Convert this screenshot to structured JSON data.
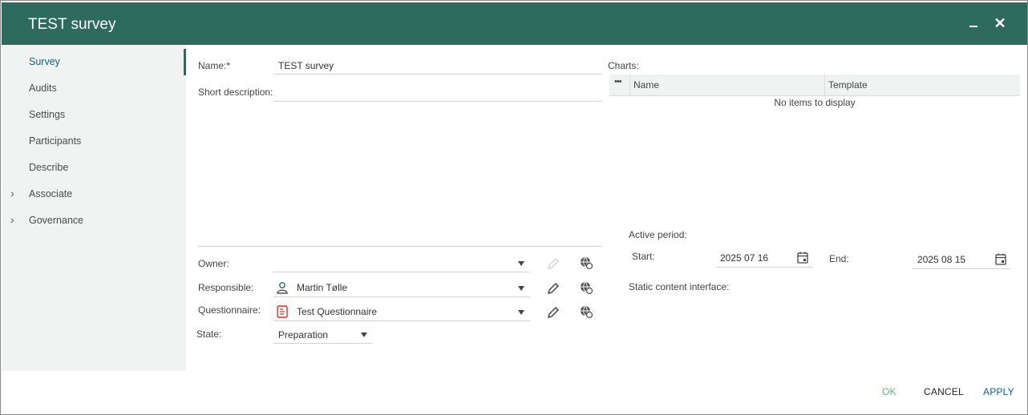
{
  "window": {
    "title": "TEST survey"
  },
  "sidebar": {
    "items": [
      {
        "label": "Survey",
        "active": true
      },
      {
        "label": "Audits"
      },
      {
        "label": "Settings"
      },
      {
        "label": "Participants"
      },
      {
        "label": "Describe"
      },
      {
        "label": "Associate",
        "expandable": true
      },
      {
        "label": "Governance",
        "expandable": true
      }
    ]
  },
  "form": {
    "name_label": "Name:*",
    "name_value": "TEST survey",
    "short_description_label": "Short description:",
    "owner_label": "Owner:",
    "owner_value": "",
    "responsible_label": "Responsible:",
    "responsible_value": "Martin Tølle",
    "questionnaire_label": "Questionnaire:",
    "questionnaire_value": "Test Questionnaire",
    "state_label": "State:",
    "state_value": "Preparation"
  },
  "charts": {
    "label": "Charts:",
    "columns": [
      "Name",
      "Template"
    ],
    "empty_text": "No items to display",
    "menu_glyph": "•••"
  },
  "active_period": {
    "label": "Active period:",
    "start_label": "Start:",
    "start_value": "2025 07 16",
    "end_label": "End:",
    "end_value": "2025 08 15"
  },
  "static_content": {
    "label": "Static content interface:"
  },
  "footer": {
    "ok_label": "OK",
    "cancel_label": "CANCEL",
    "apply_label": "APPLY"
  },
  "colors": {
    "header": "#2e6b5e",
    "accent_blue": "#0f5f88",
    "ok_green": "#5fb37a"
  },
  "icons": [
    "minimize-icon",
    "close-icon",
    "chevron-right-icon",
    "pencil-icon",
    "globe-link-icon",
    "person-icon",
    "questionnaire-icon",
    "calendar-icon",
    "dropdown-caret-icon"
  ]
}
